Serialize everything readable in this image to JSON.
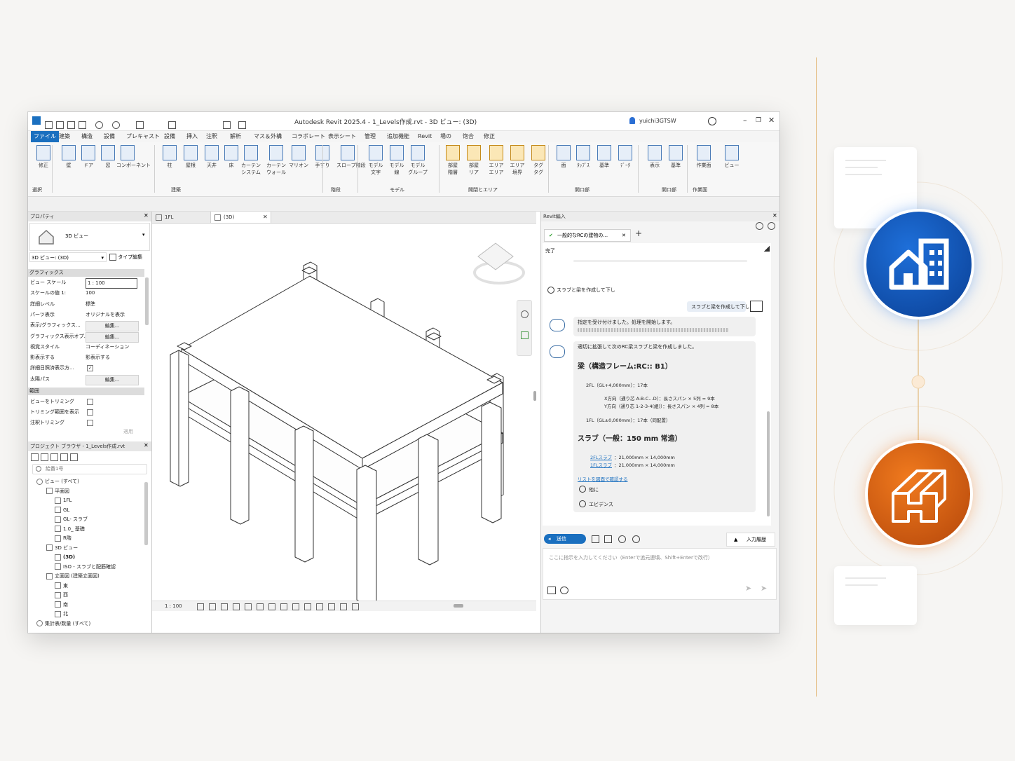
{
  "titlebar": {
    "title": "Autodesk Revit 2025.4 - 1_Levels作成.rvt - 3D ビュー: (3D)",
    "user": "yuichi3GTSW"
  },
  "ribbon_tabs": [
    "ファイル",
    "建築",
    "構造",
    "設備",
    "プレキャスト",
    "設備",
    "挿入",
    "注釈",
    "解析",
    "マス＆外構",
    "コラボレート",
    "表示シート",
    "管理",
    "追加機能",
    "Revit",
    "場の",
    "饱合",
    "修正"
  ],
  "ribbon": {
    "buttons": [
      {
        "label": "修正"
      },
      {
        "label": "壁"
      },
      {
        "label": "ドア"
      },
      {
        "label": "窓"
      },
      {
        "label": "コンポーネント"
      },
      {
        "label": "柱"
      },
      {
        "label": "屋根"
      },
      {
        "label": "天井"
      },
      {
        "label": "床"
      },
      {
        "label": "カーテン\nシステム"
      },
      {
        "label": "カーテン\nウォール"
      },
      {
        "label": "マリオン"
      },
      {
        "label": "手すり"
      },
      {
        "label": "スロープ階段"
      },
      {
        "label": "モデル\n文字"
      },
      {
        "label": "モデル\n線"
      },
      {
        "label": "モデル\nグループ"
      },
      {
        "label": "部屋\n階層"
      },
      {
        "label": "部屋\nリア"
      },
      {
        "label": "エリア\nエリア"
      },
      {
        "label": "エリア\n境界"
      },
      {
        "label": "タグ\nタグ"
      },
      {
        "label": "面"
      },
      {
        "label": "ﾀｯﾌﾟｽ"
      },
      {
        "label": "基準"
      },
      {
        "label": "ﾃﾞｰﾀ"
      },
      {
        "label": "表示"
      },
      {
        "label": "基準"
      },
      {
        "label": "作業面"
      },
      {
        "label": "ビュー"
      }
    ],
    "groups": [
      "選択",
      "建築",
      "階段",
      "モデル",
      "開閉とエリア",
      "開口部",
      "開口部",
      "作業面"
    ]
  },
  "properties": {
    "header": "プロパティ",
    "type_name": "3D ビュー",
    "view_selector": "3D ビュー: (3D)",
    "edit_type": "タイプ編集",
    "section_graphics": "グラフィックス",
    "rows": [
      {
        "name": "ビュー スケール",
        "value": "1 : 100"
      },
      {
        "name": "スケールの値    1:",
        "value": "100"
      },
      {
        "name": "詳細レベル",
        "value": "標準"
      },
      {
        "name": "パーツ表示",
        "value": "オリジナルを表示"
      },
      {
        "name": "表示/グラフィックス...",
        "value": "編集..."
      },
      {
        "name": "グラフィックス表示オプ...",
        "value": "編集..."
      },
      {
        "name": "視覚スタイル",
        "value": "コーディネーション"
      },
      {
        "name": "影表示する",
        "value": "影表示する"
      },
      {
        "name": "詳細日照済表示方...",
        "value": ""
      },
      {
        "name": "太陽パス",
        "value": "編集..."
      }
    ],
    "section_extents": "範囲",
    "extents_rows": [
      "ビューをトリミング",
      "トリミング範囲を表示",
      "注釈トリミング"
    ],
    "apply": "適用"
  },
  "browser": {
    "header": "プロジェクト ブラウザ - 1_Levels作成.rvt",
    "search_placeholder": "絵番1号",
    "tree": [
      {
        "indent": 0,
        "label": "ビュー (すべて)"
      },
      {
        "indent": 1,
        "label": "平面図"
      },
      {
        "indent": 2,
        "label": "1FL"
      },
      {
        "indent": 2,
        "label": "GL"
      },
      {
        "indent": 2,
        "label": "GL- スラブ"
      },
      {
        "indent": 2,
        "label": "1.0_ 基礎"
      },
      {
        "indent": 2,
        "label": "R階"
      },
      {
        "indent": 1,
        "label": "3D ビュー"
      },
      {
        "indent": 2,
        "label": "(3D)"
      },
      {
        "indent": 2,
        "label": "ISO - スラブと配筋確認"
      },
      {
        "indent": 1,
        "label": "立面図 (建築立面図)"
      },
      {
        "indent": 2,
        "label": "東"
      },
      {
        "indent": 2,
        "label": "西"
      },
      {
        "indent": 2,
        "label": "南"
      },
      {
        "indent": 2,
        "label": "北"
      },
      {
        "indent": 0,
        "label": "集計表/数量 (すべて)"
      }
    ]
  },
  "view": {
    "tabs": [
      "1FL",
      "(3D)"
    ],
    "scale": "1 : 100"
  },
  "assistant": {
    "header": "Revit編入",
    "chat_tab": "一般的なRCの建物の...",
    "status": "完了",
    "prompt_item": "スラブと梁を作成して下し",
    "user_message": "スラブと梁を作成して下し",
    "bot_msg1": "指定を受け付けました。処理を開始します。",
    "bot_msg2": "適切に拡張して次のRC梁スラブと梁を作成しました。",
    "heading_beam": "梁（構造フレーム:RC:: B1）",
    "beam_items": [
      "2FL（GL+4,000mm）：17本",
      "X方向（通り芯 A-B-C…D）：長さスパン × 5列 = 9本",
      "Y方向（通り芯 1-2-3-4(組)）：長さスパン × 4列 = 8本",
      "1FL（GL±0,000mm）：17本（同配置）"
    ],
    "heading_slab": "スラブ（一般：150 mm 常造）",
    "slab_items": [
      {
        "link": "2FLスラブ",
        "text": "：21,000mm × 14,000mm"
      },
      {
        "link": "1FLスラブ",
        "text": "：21,000mm × 14,000mm"
      }
    ],
    "list_link": "リストを図面で確認する",
    "options": [
      "他に",
      "エビデンス"
    ],
    "send_label": "送信",
    "history_label": "入力履歴",
    "input_placeholder": "ここに指示を入力してください（Enterで追元連填、Shift+Enterで改行）"
  },
  "colors": {
    "accent": "#1a6fbf",
    "icon_blue": "#0d4fa8",
    "icon_orange": "#d9620c",
    "gold_line": "#e3b97a"
  }
}
